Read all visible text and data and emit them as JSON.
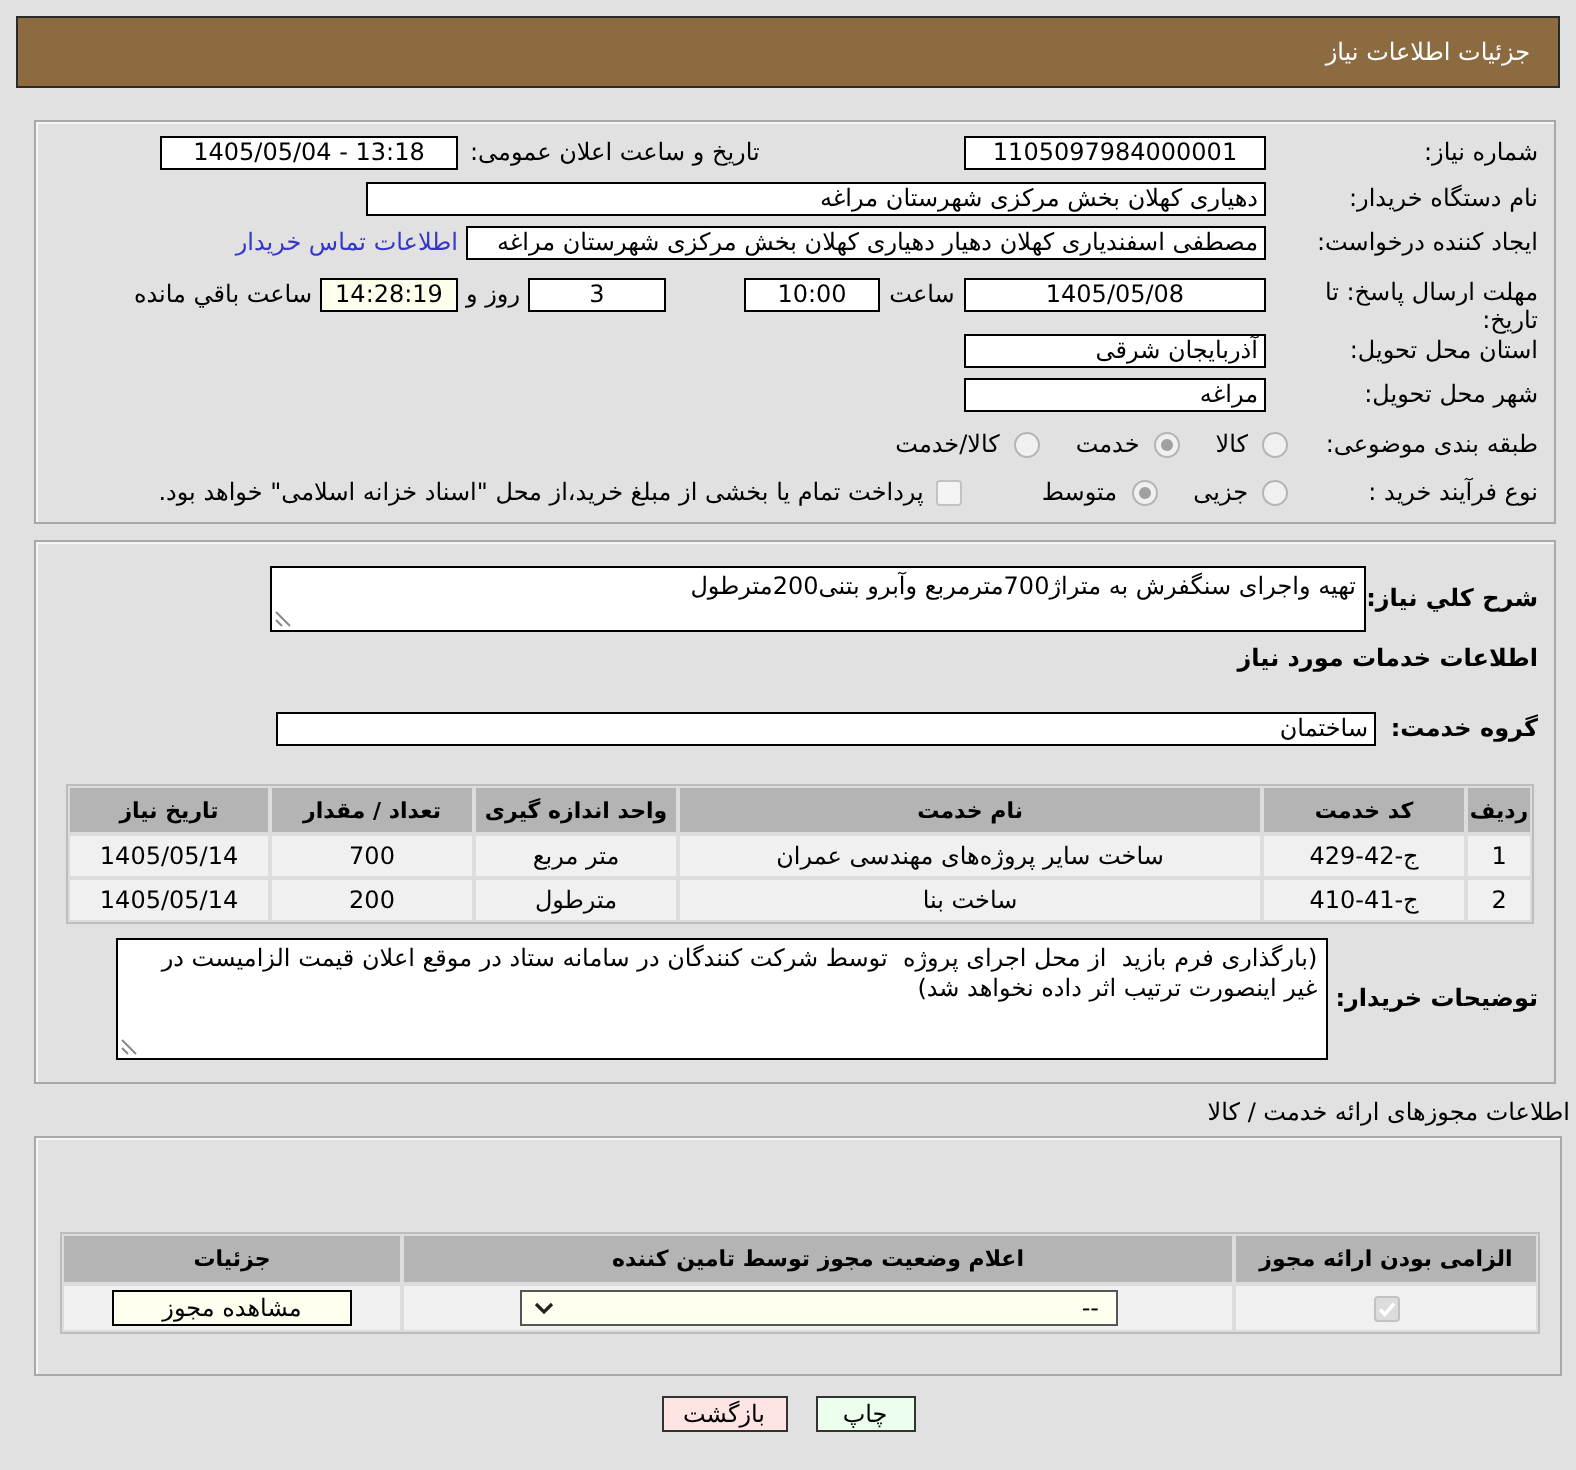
{
  "header": {
    "title": "جزئیات اطلاعات نیاز"
  },
  "need_info": {
    "need_number": {
      "label": "شماره نیاز:",
      "value": "1105097984000001"
    },
    "announce_date": {
      "label": "تاریخ و ساعت اعلان عمومی:",
      "value": "1405/05/04 - 13:18"
    },
    "buyer_org": {
      "label": "نام دستگاه خریدار:",
      "value": "دهیاری کهلان بخش مرکزی شهرستان مراغه"
    },
    "requester": {
      "label": "ایجاد کننده درخواست:",
      "value": "مصطفی اسفندیاری کهلان دهیار دهیاری کهلان بخش مرکزی شهرستان مراغه",
      "contact_link": "اطلاعات تماس خریدار"
    },
    "deadline": {
      "label": "مهلت ارسال پاسخ: تا تاریخ:",
      "date": "1405/05/08",
      "time_label": "ساعت",
      "time": "10:00",
      "days": "3",
      "days_label": "روز و",
      "remaining": "14:28:19",
      "remaining_label": "ساعت باقي مانده"
    },
    "province": {
      "label": "استان محل تحویل:",
      "value": "آذربایجان شرقی"
    },
    "city": {
      "label": "شهر محل تحویل:",
      "value": "مراغه"
    },
    "category": {
      "label": "طبقه بندی موضوعی:",
      "disabled": true,
      "options": [
        {
          "label": "کالا",
          "selected": false
        },
        {
          "label": "خدمت",
          "selected": true
        },
        {
          "label": "کالا/خدمت",
          "selected": false
        }
      ]
    },
    "purchase_type": {
      "label": "نوع فرآیند خرید :",
      "disabled": true,
      "options": [
        {
          "label": "جزیی",
          "selected": false
        },
        {
          "label": "متوسط",
          "selected": true
        }
      ],
      "treasury_option": {
        "label": "پرداخت تمام یا بخشی از مبلغ خرید،از محل \"اسناد خزانه اسلامی\" خواهد بود.",
        "checked": false,
        "disabled": true
      }
    }
  },
  "services": {
    "description": {
      "label": "شرح کلي نیاز:",
      "value": "تهیه واجرای سنگفرش به متراژ700مترمربع وآبرو بتنی200مترطول"
    },
    "title": "اطلاعات خدمات مورد نیاز",
    "group": {
      "label": "گروه خدمت:",
      "value": "ساختمان"
    },
    "table": {
      "columns": [
        "ردیف",
        "کد خدمت",
        "نام خدمت",
        "واحد اندازه گیری",
        "تعداد / مقدار",
        "تاریخ نیاز"
      ],
      "rows": [
        [
          "1",
          "ج-42-429",
          "ساخت سایر پروژه‌های مهندسی عمران",
          "متر مربع",
          "700",
          "1405/05/14"
        ],
        [
          "2",
          "ج-41-410",
          "ساخت بنا",
          "مترطول",
          "200",
          "1405/05/14"
        ]
      ]
    },
    "buyer_notes": {
      "label": "توضیحات خریدار:",
      "value": "(بارگذاری فرم بازید  از محل اجرای پروژه  توسط شرکت کنندگان در سامانه ستاد در موقع اعلان قیمت الزامیست در غیر اینصورت ترتیب اثر داده نخواهد شد)"
    }
  },
  "licenses": {
    "title": "اطلاعات مجوزهای ارائه خدمت / کالا",
    "table": {
      "columns": [
        "الزامی بودن ارائه مجوز",
        "اعلام وضعیت مجوز توسط تامین کننده",
        "جزئیات"
      ],
      "rows": [
        {
          "required": true,
          "disabled": true,
          "status": "--",
          "details_button": "مشاهده مجوز"
        }
      ]
    }
  },
  "buttons": [
    {
      "label": "چاپ",
      "kind": "print"
    },
    {
      "label": "بازگشت",
      "kind": "back"
    }
  ]
}
